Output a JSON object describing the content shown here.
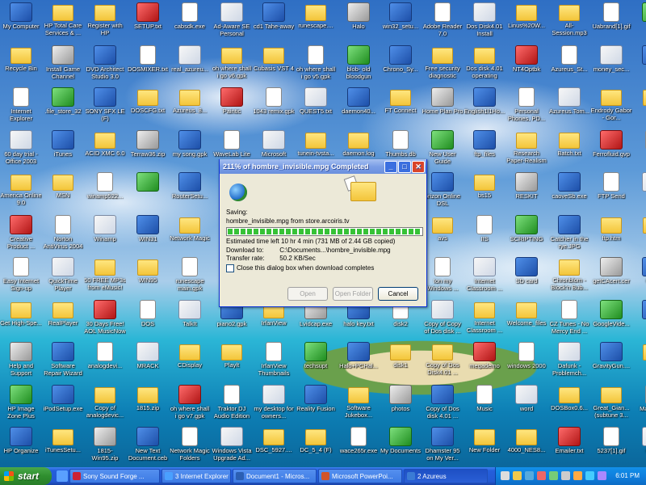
{
  "desktop": {
    "icons": [
      "My Computer",
      "HP Total Care Services & ...",
      "Register with HP",
      "SETUP.txt",
      "cabsdk.exe",
      "Ad-Aware SE Personal",
      "cd1 Tahe-away",
      "runescape....",
      "Halo",
      "win32_setu...",
      "Adobe Reader 7.0",
      "Dos Disk4.01 Install",
      "Linus%20W...",
      "All-Session.mp3",
      "Uabrand[1].gif",
      "Ver",
      "Recycle Bin",
      "Install Game Channel",
      "DVD Architect Studio 3.0",
      "DOSMIXER.txt",
      "real_azureu...",
      "oh where shall i go v6.gpk",
      "Cubasis VST 4",
      "oh where shall i go v5.gpk",
      "blob- old bloodgun",
      "Chrono_Sy...",
      "Free security diagnostic",
      "Dos disk 4.01 operating",
      "NT4Optbk",
      "Azureus_St...",
      "money_sec...",
      "hpp",
      "Internet Explorer",
      ".file_store_32",
      "SONY SFX LE (F)",
      "DOSCFG.txt",
      "Azureus_8...",
      "Paintic",
      "1043 remix.gpk",
      "QUEST5.txt",
      "daemon40...",
      "FT Connect",
      "Home Plan Pro",
      "English1l1Ho...",
      "Personal Phones, PD...",
      "Azureus.Tom...",
      "Endrody Gabor - Gor...",
      "ib3",
      "60 day trial - Office 2003",
      "iTunes",
      "ACID XMC 6.0",
      "Terraw36.zip",
      "my song.gpk",
      "WaveLab Lite",
      "Microsoft",
      "tunein-tvsta...",
      "daemon.log",
      "Thumbs.db",
      "New User Guide",
      "ftp_files",
      "Research Paper-Realism",
      "Batch.txt",
      "Ferrofluid.gvp",
      "IBM",
      "America Online 9.0",
      "MSN",
      "winamp522...",
      "",
      "RouterSetu...",
      "",
      "",
      "",
      "",
      "",
      "orizon Online DSL",
      "bs15",
      "RESKIT",
      "caoveSb.exe",
      "FTP Send",
      "",
      "Creative Product ...",
      "Norton AntiVirus 2004",
      "Winamp",
      "WIN31",
      "Network Magic",
      "",
      "",
      "",
      "",
      "",
      "avs",
      "IIS",
      "SCRIPTING",
      "Catcher in the rye.JPG",
      "ftp.htm",
      "",
      "Easy Internet Sign-up",
      "QuickTime Player",
      "50 FREE MP3s from eMusic!",
      "WIN95",
      "runescape main.gpk",
      "",
      "",
      "",
      "",
      "",
      "Ion my Windows ...",
      "Internet Classroom ...",
      "SD card",
      "Chronblom - Block'n Bub...",
      "getCAcert.cer",
      "Class",
      "Get High-Spe...",
      "RealPlayer",
      "30 Days Free! AOL MusicNow",
      "DOS",
      "TalkIt",
      "piano2.gpk",
      "IrfanView",
      "Lvidcap.exe",
      "halo key.txt",
      "disk2",
      "Copy of Copy of Dos disk ...",
      "Internet Classroom ...",
      "Welcome_files",
      "CZ Tunes - No Mercy End ...",
      "GoogleVide...",
      "Inst",
      "Help and Support",
      "Software Repair Wizard",
      "analogdevi...",
      "MRACK",
      "CDisplay",
      "Playlt",
      "IrfanView Thumbnails",
      "techsupt",
      "Halo+PCHal...",
      "disk1",
      "Copy of Dos Disk4.01 ...",
      "megademo",
      "windows 2000",
      "Dafunk - Problemch...",
      "GravityGun....",
      "",
      "HP Image Zone Plus",
      "iPodSetup.exe",
      "Copy of analogdevic...",
      "1815.zip",
      "oh where shall i go v7.gpk",
      "Traktor DJ Audio Edition",
      "my desktop for owners...",
      "Reality Fusion",
      "Software Jukebox...",
      "photos",
      "Copy of Dos disk 4.01 ...",
      "Music",
      "word",
      "DOSBox0.6...",
      "Great_Gian... (subtune 3...",
      "Mald Setu",
      "HP Organize",
      "iTunesSetu...",
      "1815-Win95.zip",
      "New Text Document.ceb",
      "Network Magic Folders",
      "Windows Vista Upgrade Ad...",
      "DSC_5927....",
      "DC_5_4 (F)",
      "wace265r.exe",
      "My Documents",
      "Dhamster 95 on My Ver...",
      "New Folder",
      "4000_NES8...",
      "Emailer.txt",
      "5237[1].gif",
      "mega"
    ]
  },
  "dialog": {
    "title": "211% of hombre_invisible.mpg Completed",
    "saving_label": "Saving:",
    "filename_line": "hombre_invisible.mpg from store.arcoiris.tv",
    "progress_fraction": 1.0,
    "time_left_label": "Estimated time left",
    "time_left_value": "10 hr 4 min (731 MB of 2.44 GB copied)",
    "download_to_label": "Download to:",
    "download_to_value": "C:\\Documents...\\hombre_invisible.mpg",
    "transfer_rate_label": "Transfer rate:",
    "transfer_rate_value": "50.2 KB/Sec",
    "close_checkbox_label": "Close this dialog box when download completes",
    "open_button": "Open",
    "open_folder_button": "Open Folder",
    "cancel_button": "Cancel",
    "min_glyph": "_",
    "max_glyph": "□",
    "close_glyph": "✕"
  },
  "taskbar": {
    "start_label": "start",
    "tasks": [
      "Sony Sound Forge ...",
      "3 Internet Explorer",
      "Document1 - Micros...",
      "Microsoft PowerPoi...",
      "2 Azureus"
    ],
    "clock": "6:01 PM"
  },
  "colors": {
    "taskbar_blue": "#245edb",
    "start_green": "#2f8f2f",
    "dialog_face": "#ece9d8",
    "progress_green": "#36c236",
    "close_red": "#d9452b"
  }
}
